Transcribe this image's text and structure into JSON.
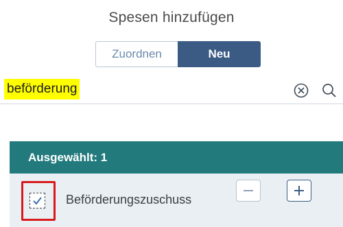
{
  "dialog": {
    "title": "Spesen hinzufügen"
  },
  "segmented": {
    "left_label": "Zuordnen",
    "right_label": "Neu",
    "selected": "Neu"
  },
  "search": {
    "value": "beförderung"
  },
  "selection": {
    "header": "Ausgewählt: 1",
    "items": [
      {
        "label": "Beförderungszuschuss",
        "checked": true
      }
    ]
  },
  "icons": {
    "clear": "clear-circle-x-icon",
    "search": "magnifier-icon",
    "minus": "minus-icon",
    "plus": "plus-icon",
    "check": "checkmark-icon"
  },
  "colors": {
    "header_bg": "#227a7d",
    "row_bg": "#e9eff3",
    "active_segment": "#3b5b84",
    "search_highlight": "#ffff00",
    "annotation_border": "#d7191c"
  }
}
